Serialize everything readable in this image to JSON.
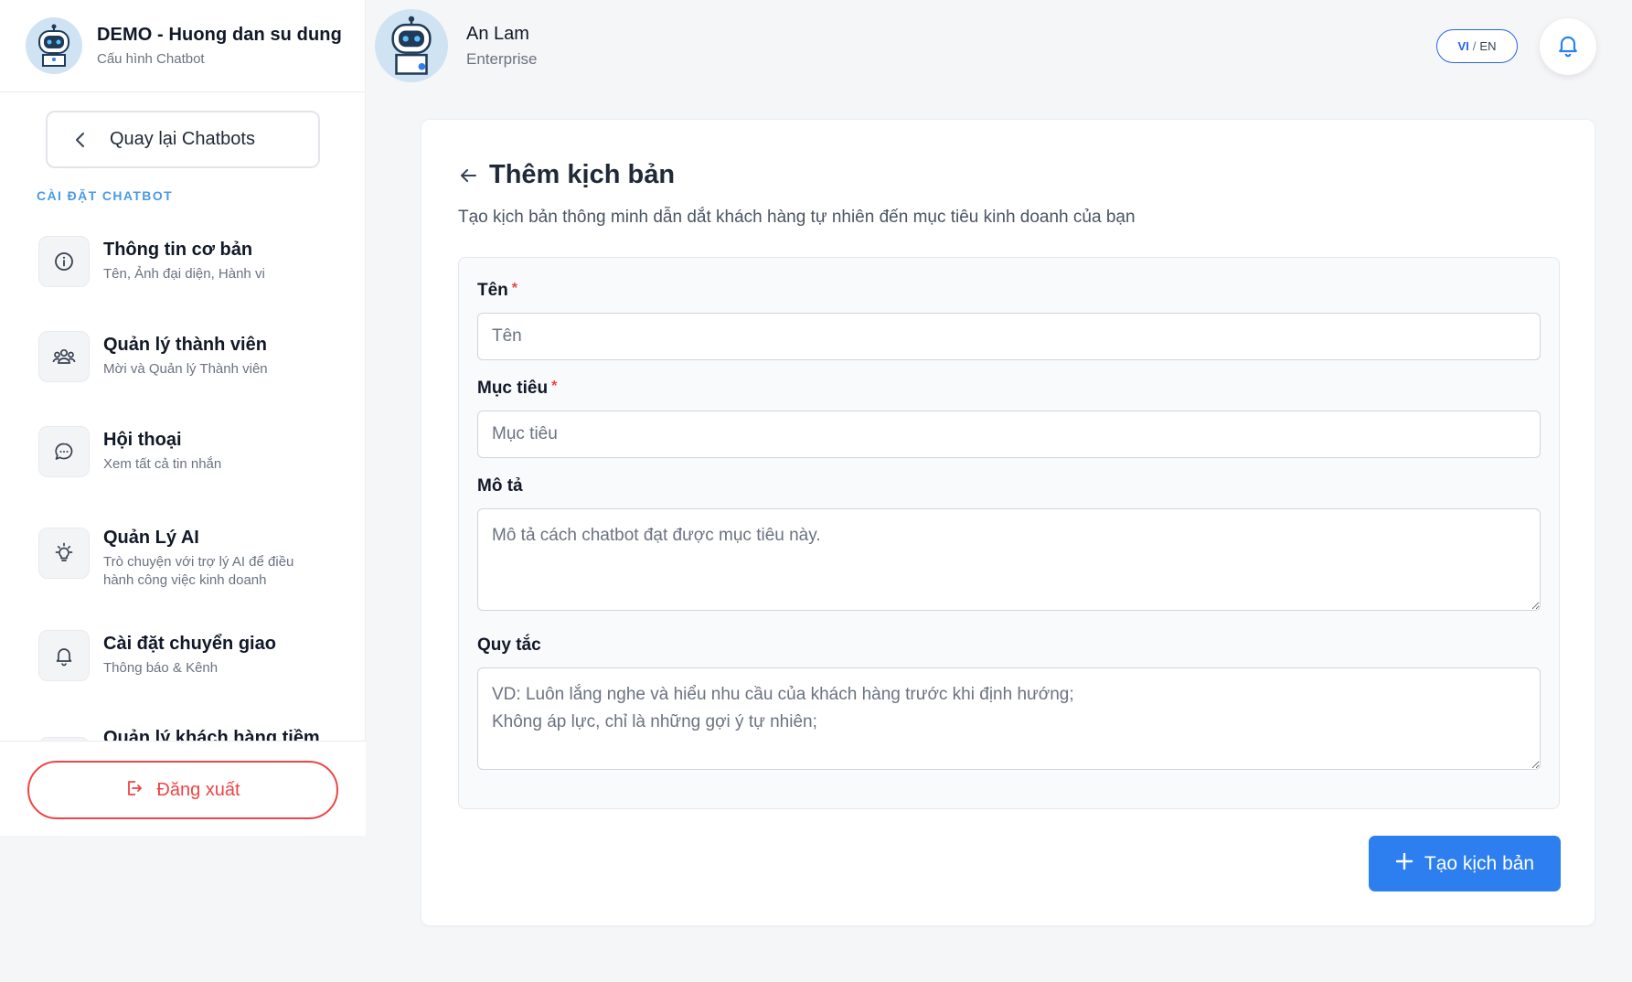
{
  "sidebar": {
    "brand_title": "DEMO - Huong dan su dung",
    "brand_subtitle": "Cấu hình Chatbot",
    "back_label": "Quay lại Chatbots",
    "section_label": "CÀI ĐẶT CHATBOT",
    "items": [
      {
        "title": "Thông tin cơ bản",
        "subtitle": "Tên, Ảnh đại diện, Hành vi",
        "icon": "info-icon"
      },
      {
        "title": "Quản lý thành viên",
        "subtitle": "Mời và Quản lý Thành viên",
        "icon": "users-icon"
      },
      {
        "title": "Hội thoại",
        "subtitle": "Xem tất cả tin nhắn",
        "icon": "chat-icon"
      },
      {
        "title": "Quản Lý AI",
        "subtitle": "Trò chuyện với trợ lý AI để điều hành công việc kinh doanh",
        "icon": "lightbulb-icon"
      },
      {
        "title": "Cài đặt chuyển giao",
        "subtitle": "Thông báo & Kênh",
        "icon": "bell-icon"
      },
      {
        "title": "Quản lý khách hàng tiềm",
        "subtitle": "",
        "icon": "leads-icon"
      }
    ],
    "logout_label": "Đăng xuất"
  },
  "header": {
    "user_name": "An Lam",
    "user_plan": "Enterprise",
    "lang_vi": "VI",
    "lang_sep": "/",
    "lang_en": "EN"
  },
  "main": {
    "title": "Thêm kịch bản",
    "description": "Tạo kịch bản thông minh dẫn dắt khách hàng tự nhiên đến mục tiêu kinh doanh của bạn",
    "fields": {
      "name": {
        "label": "Tên",
        "required_mark": "*",
        "placeholder": "Tên",
        "value": ""
      },
      "goal": {
        "label": "Mục tiêu",
        "required_mark": "*",
        "placeholder": "Mục tiêu",
        "value": ""
      },
      "description": {
        "label": "Mô tả",
        "placeholder": "Mô tả cách chatbot đạt được mục tiêu này.",
        "value": ""
      },
      "rules": {
        "label": "Quy tắc",
        "placeholder": "VD: Luôn lắng nghe và hiểu nhu cầu của khách hàng trước khi định hướng;\nKhông áp lực, chỉ là những gợi ý tự nhiên;",
        "value": ""
      }
    },
    "submit_label": "Tạo kịch bản"
  },
  "colors": {
    "accent": "#2d7ff0",
    "section_label": "#4a9be6",
    "danger": "#ef4444"
  }
}
